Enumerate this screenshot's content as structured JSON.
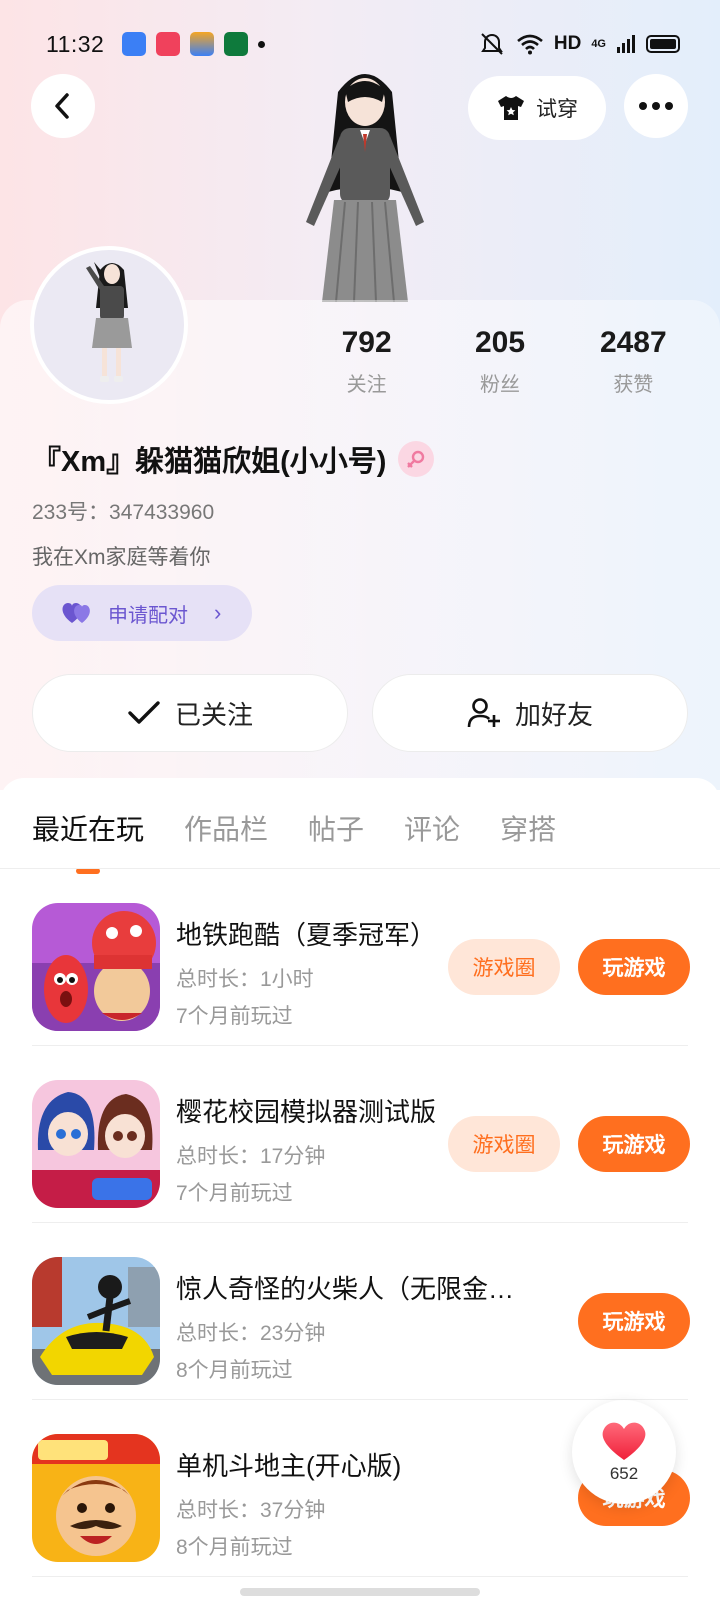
{
  "status_bar": {
    "time": "11:32",
    "network": "HD",
    "signal": "4G"
  },
  "header": {
    "back_icon": "back-arrow-icon",
    "try_on_label": "试穿",
    "more_icon": "more-dots-icon"
  },
  "profile": {
    "stats": [
      {
        "value": "792",
        "label": "关注"
      },
      {
        "value": "205",
        "label": "粉丝"
      },
      {
        "value": "2487",
        "label": "获赞"
      }
    ],
    "nickname": "『Xm』躲猫猫欣姐(小小号)",
    "gender": "female",
    "uid": "233号：347433960",
    "bio": "我在Xm家庭等着你",
    "pair_label": "申请配对",
    "followed_label": "已关注",
    "add_friend_label": "加好友"
  },
  "tabs": [
    {
      "label": "最近在玩",
      "active": true
    },
    {
      "label": "作品栏",
      "active": false
    },
    {
      "label": "帖子",
      "active": false
    },
    {
      "label": "评论",
      "active": false
    },
    {
      "label": "穿搭",
      "active": false
    }
  ],
  "games": [
    {
      "name": "地铁跑酷（夏季冠军）",
      "duration": "总时长：1小时",
      "last_played": "7个月前玩过",
      "circle_label": "游戏圈",
      "play_label": "玩游戏"
    },
    {
      "name": "樱花校园模拟器测试版",
      "duration": "总时长：17分钟",
      "last_played": "7个月前玩过",
      "circle_label": "游戏圈",
      "play_label": "玩游戏"
    },
    {
      "name": "惊人奇怪的火柴人（无限金币）",
      "duration": "总时长：23分钟",
      "last_played": "8个月前玩过",
      "play_label": "玩游戏"
    },
    {
      "name": "单机斗地主(开心版)",
      "duration": "总时长：37分钟",
      "last_played": "8个月前玩过",
      "play_label": "玩游戏"
    }
  ],
  "like_float": {
    "count": "652"
  },
  "colors": {
    "accent": "#ff6f1f",
    "pair": "#6b56d0"
  }
}
